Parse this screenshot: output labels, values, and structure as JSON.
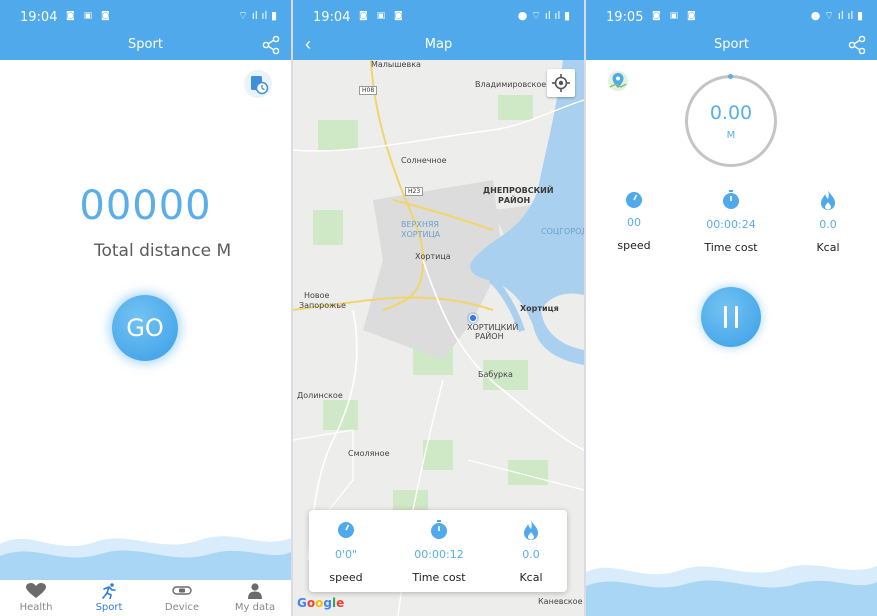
{
  "colors": {
    "accent": "#4fa9ea",
    "value_blue": "#5aaee9",
    "wave_light": "#d8ecfb",
    "wave_mid": "#a9d6f5"
  },
  "screen1": {
    "status": {
      "time": "19:04",
      "indicators": "◙ ▣ ◙",
      "system": "⌔ ıl ıl ▮"
    },
    "title": "Sport",
    "distance_value": "00000",
    "distance_label": "Total distance M",
    "go_label": "GO",
    "nav": [
      {
        "label": "Health",
        "icon": "heart-icon",
        "active": false
      },
      {
        "label": "Sport",
        "icon": "runner-icon",
        "active": true
      },
      {
        "label": "Device",
        "icon": "band-icon",
        "active": false
      },
      {
        "label": "My data",
        "icon": "person-icon",
        "active": false
      }
    ]
  },
  "screen2": {
    "status": {
      "time": "19:04",
      "indicators": "◙ ▣ ◙",
      "system": "● ⌔ ıl ıl ▮"
    },
    "title": "Map",
    "map_labels": [
      "Малышевка",
      "Владимировское",
      "Солнечное",
      "ДНЕПРОВСКИЙ",
      "РАЙОН",
      "СОЦГОРОД",
      "ВЕРХНЯЯ",
      "ХОРТИЦА",
      "Хортица",
      "Новое",
      "Запорожье",
      "Хортиця",
      "ХОРТИЦКИЙ",
      "РАЙОН",
      "Бабурка",
      "Долинское",
      "Смоляное",
      "Канeвское"
    ],
    "highways": [
      "H08",
      "H23"
    ],
    "google": "Google",
    "stats": {
      "speed": {
        "value": "0'0\"",
        "label": "speed"
      },
      "time": {
        "value": "00:00:12",
        "label": "Time cost"
      },
      "kcal": {
        "value": "0.0",
        "label": "Kcal"
      }
    }
  },
  "screen3": {
    "status": {
      "time": "19:05",
      "indicators": "◙ ▣ ◙",
      "system": "● ⌔ ıl ıl ▮"
    },
    "title": "Sport",
    "distance_value": "0.00",
    "distance_unit": "M",
    "stats": {
      "speed": {
        "value": "00",
        "label": "speed"
      },
      "time": {
        "value": "00:00:24",
        "label": "Time cost"
      },
      "kcal": {
        "value": "0.0",
        "label": "Kcal"
      }
    }
  }
}
